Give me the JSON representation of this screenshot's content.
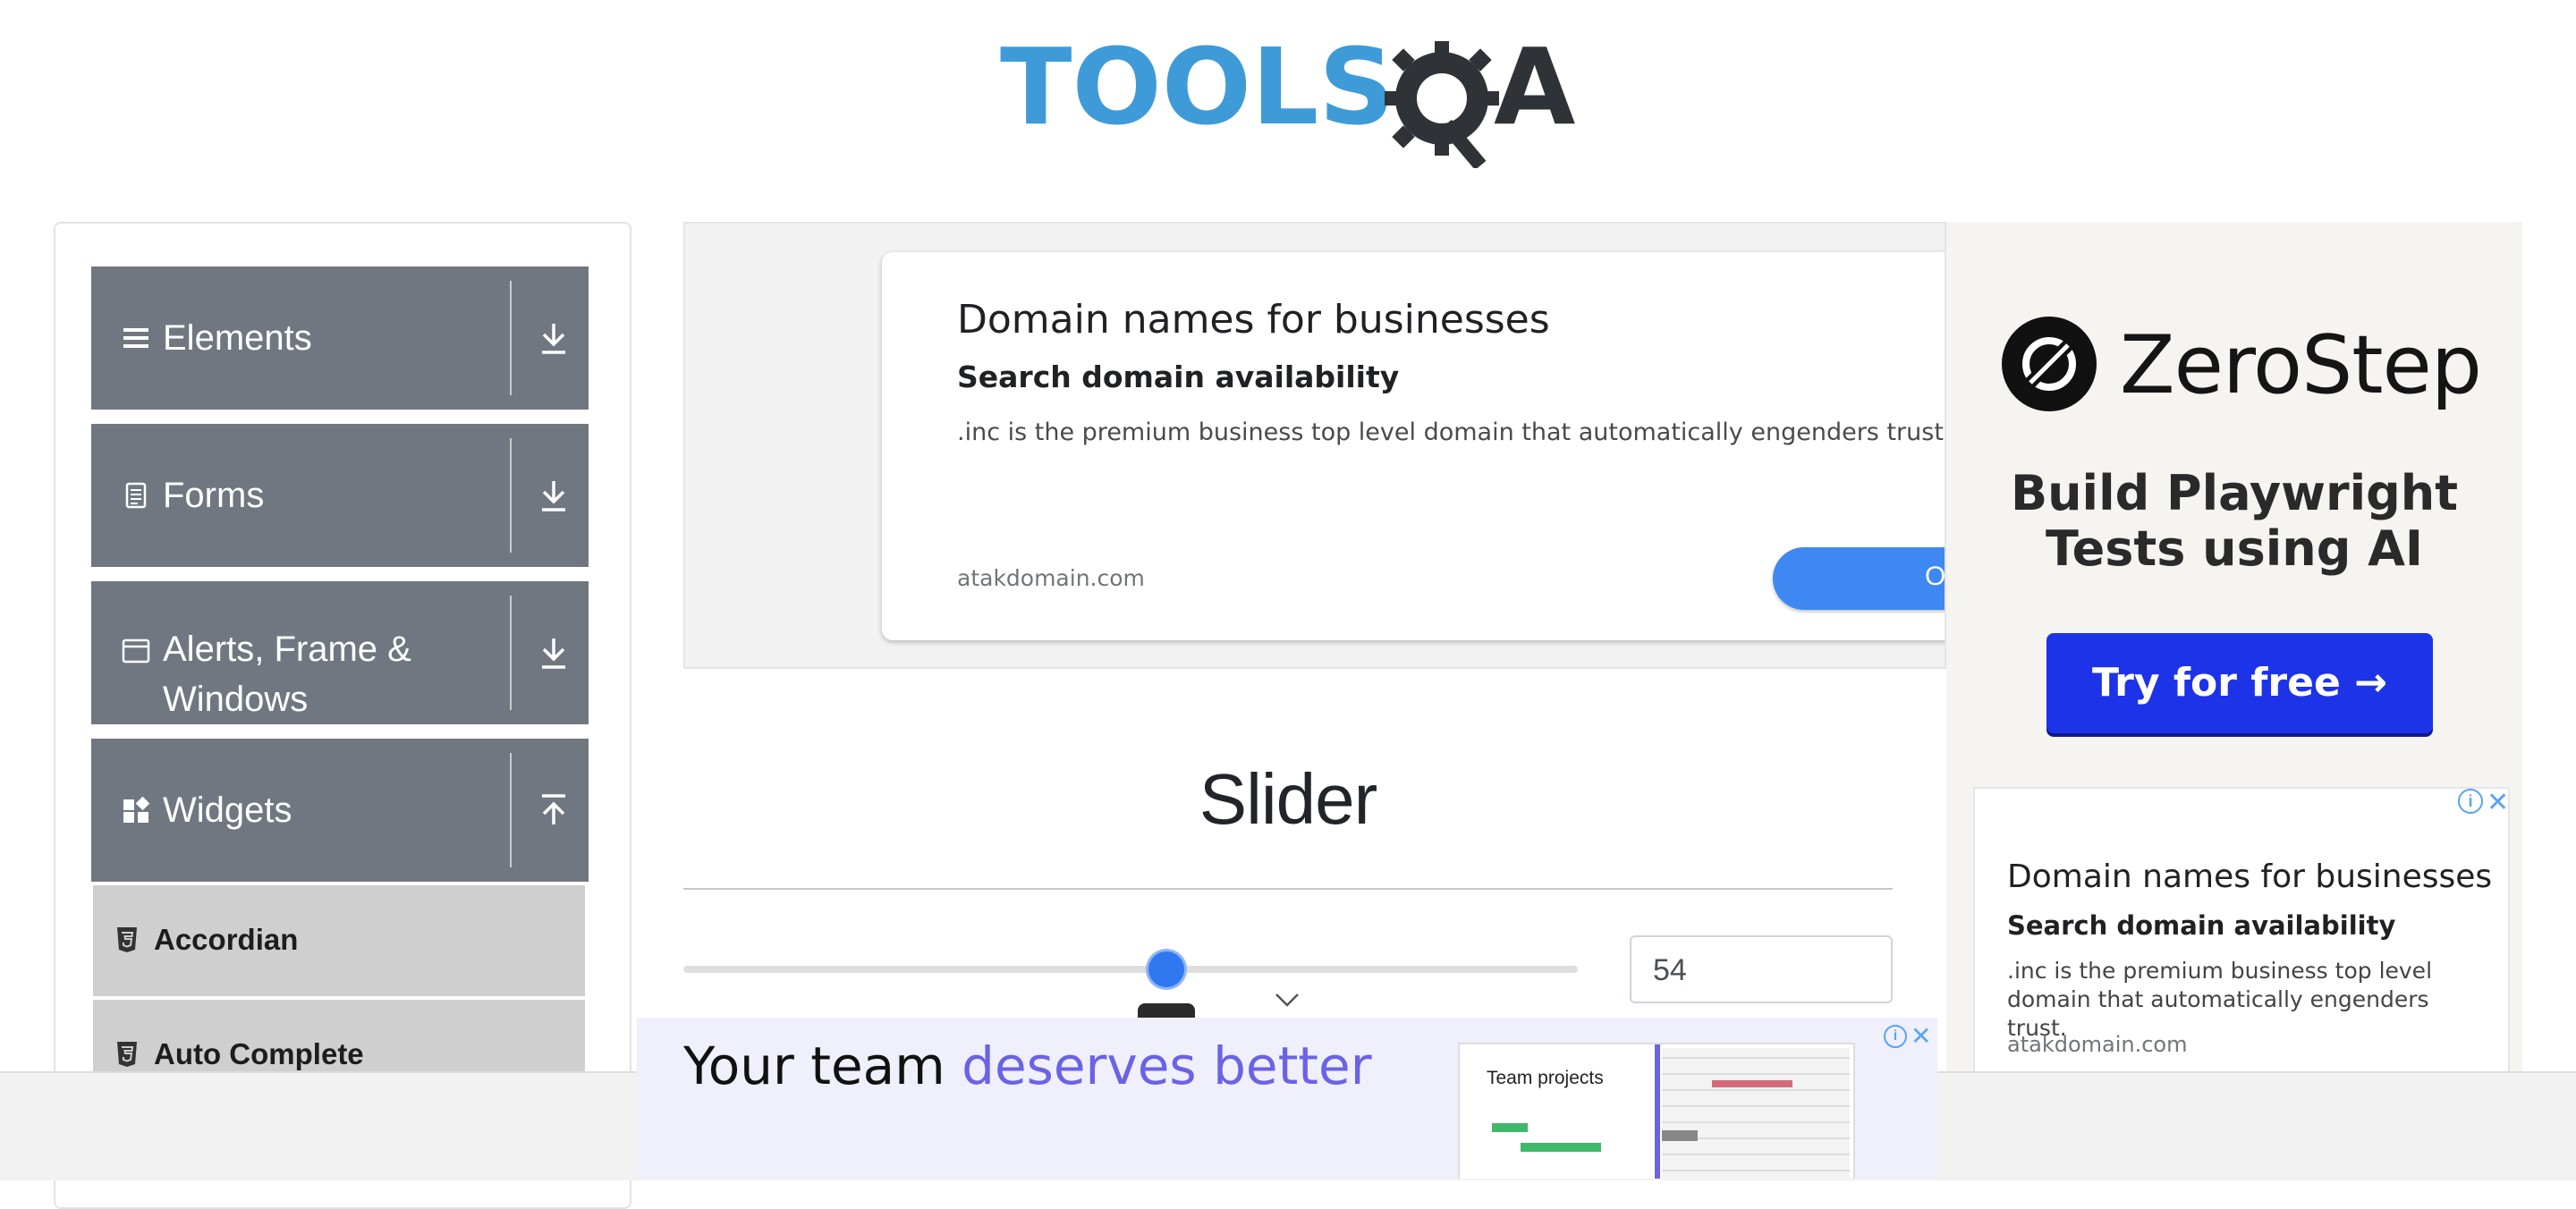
{
  "logo": {
    "part1": "TOOLS",
    "part2": "A"
  },
  "sidebar": {
    "groups": [
      {
        "label": "Elements",
        "icon": "menu-icon"
      },
      {
        "label": "Forms",
        "icon": "document-icon"
      },
      {
        "label": "Alerts, Frame &",
        "label2": "Windows",
        "icon": "window-icon"
      },
      {
        "label": "Widgets",
        "icon": "widgets-icon"
      }
    ],
    "items": [
      {
        "label": "Accordian",
        "icon": "html5-icon"
      },
      {
        "label": "Auto Complete",
        "icon": "html5-icon"
      }
    ]
  },
  "center_ad": {
    "title": "Domain names for businesses",
    "subtitle": "Search domain availability",
    "body": ".inc is the premium business top level domain that automatically engenders trust.",
    "url": "atakdomain.com",
    "button_partial": "O"
  },
  "right_ad": {
    "brand": "ZeroStep",
    "headline_line1": "Build Playwright",
    "headline_line2": "Tests using AI",
    "cta": "Try for free →",
    "card": {
      "title": "Domain names for businesses",
      "subtitle": "Search domain availability",
      "body": ".inc is the premium business top level domain that automatically engenders trust.",
      "url": "atakdomain.com"
    }
  },
  "main": {
    "title": "Slider",
    "slider": {
      "value": "54",
      "min": 0,
      "max": 100
    }
  },
  "bottom_ad": {
    "headline_plain": "Your team ",
    "headline_accent": "deserves better",
    "preview_title": "Team projects"
  }
}
